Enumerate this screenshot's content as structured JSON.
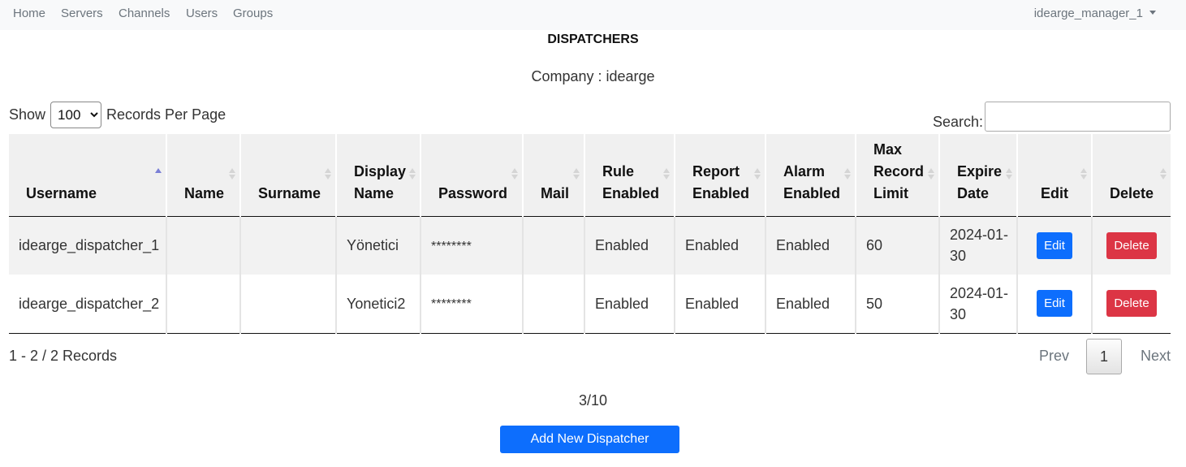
{
  "nav": {
    "links": [
      "Home",
      "Servers",
      "Channels",
      "Users",
      "Groups"
    ],
    "user_menu": "idearge_manager_1"
  },
  "page": {
    "title": "DISPATCHERS",
    "company_label": "Company : idearge"
  },
  "controls": {
    "show_label": "Show",
    "per_page_value": "100",
    "per_page_suffix": "Records Per Page",
    "search_label": "Search:",
    "search_value": ""
  },
  "table": {
    "headers": [
      "Username",
      "Name",
      "Surname",
      "Display Name",
      "Password",
      "Mail",
      "Rule Enabled",
      "Report Enabled",
      "Alarm Enabled",
      "Max Record Limit",
      "Expire Date",
      "Edit",
      "Delete"
    ],
    "sorted_column": "Username",
    "sort_direction": "ascending",
    "rows": [
      {
        "username": "idearge_dispatcher_1",
        "name": "",
        "surname": "",
        "display_name": "Yönetici",
        "password": "********",
        "mail": "",
        "rule_enabled": "Enabled",
        "report_enabled": "Enabled",
        "alarm_enabled": "Enabled",
        "max_record_limit": "60",
        "expire_date": "2024-01-30",
        "edit_label": "Edit",
        "delete_label": "Delete"
      },
      {
        "username": "idearge_dispatcher_2",
        "name": "",
        "surname": "",
        "display_name": "Yonetici2",
        "password": "********",
        "mail": "",
        "rule_enabled": "Enabled",
        "report_enabled": "Enabled",
        "alarm_enabled": "Enabled",
        "max_record_limit": "50",
        "expire_date": "2024-01-30",
        "edit_label": "Edit",
        "delete_label": "Delete"
      }
    ]
  },
  "footer": {
    "records_info": "1 - 2 / 2 Records",
    "prev_label": "Prev",
    "current_page": "1",
    "next_label": "Next",
    "count": "3/10",
    "add_button": "Add New Dispatcher"
  },
  "colors": {
    "primary": "#0d6efd",
    "danger": "#dc3545",
    "sort_active": "#7a7fd6",
    "navbar_bg": "#f8f9fa"
  }
}
